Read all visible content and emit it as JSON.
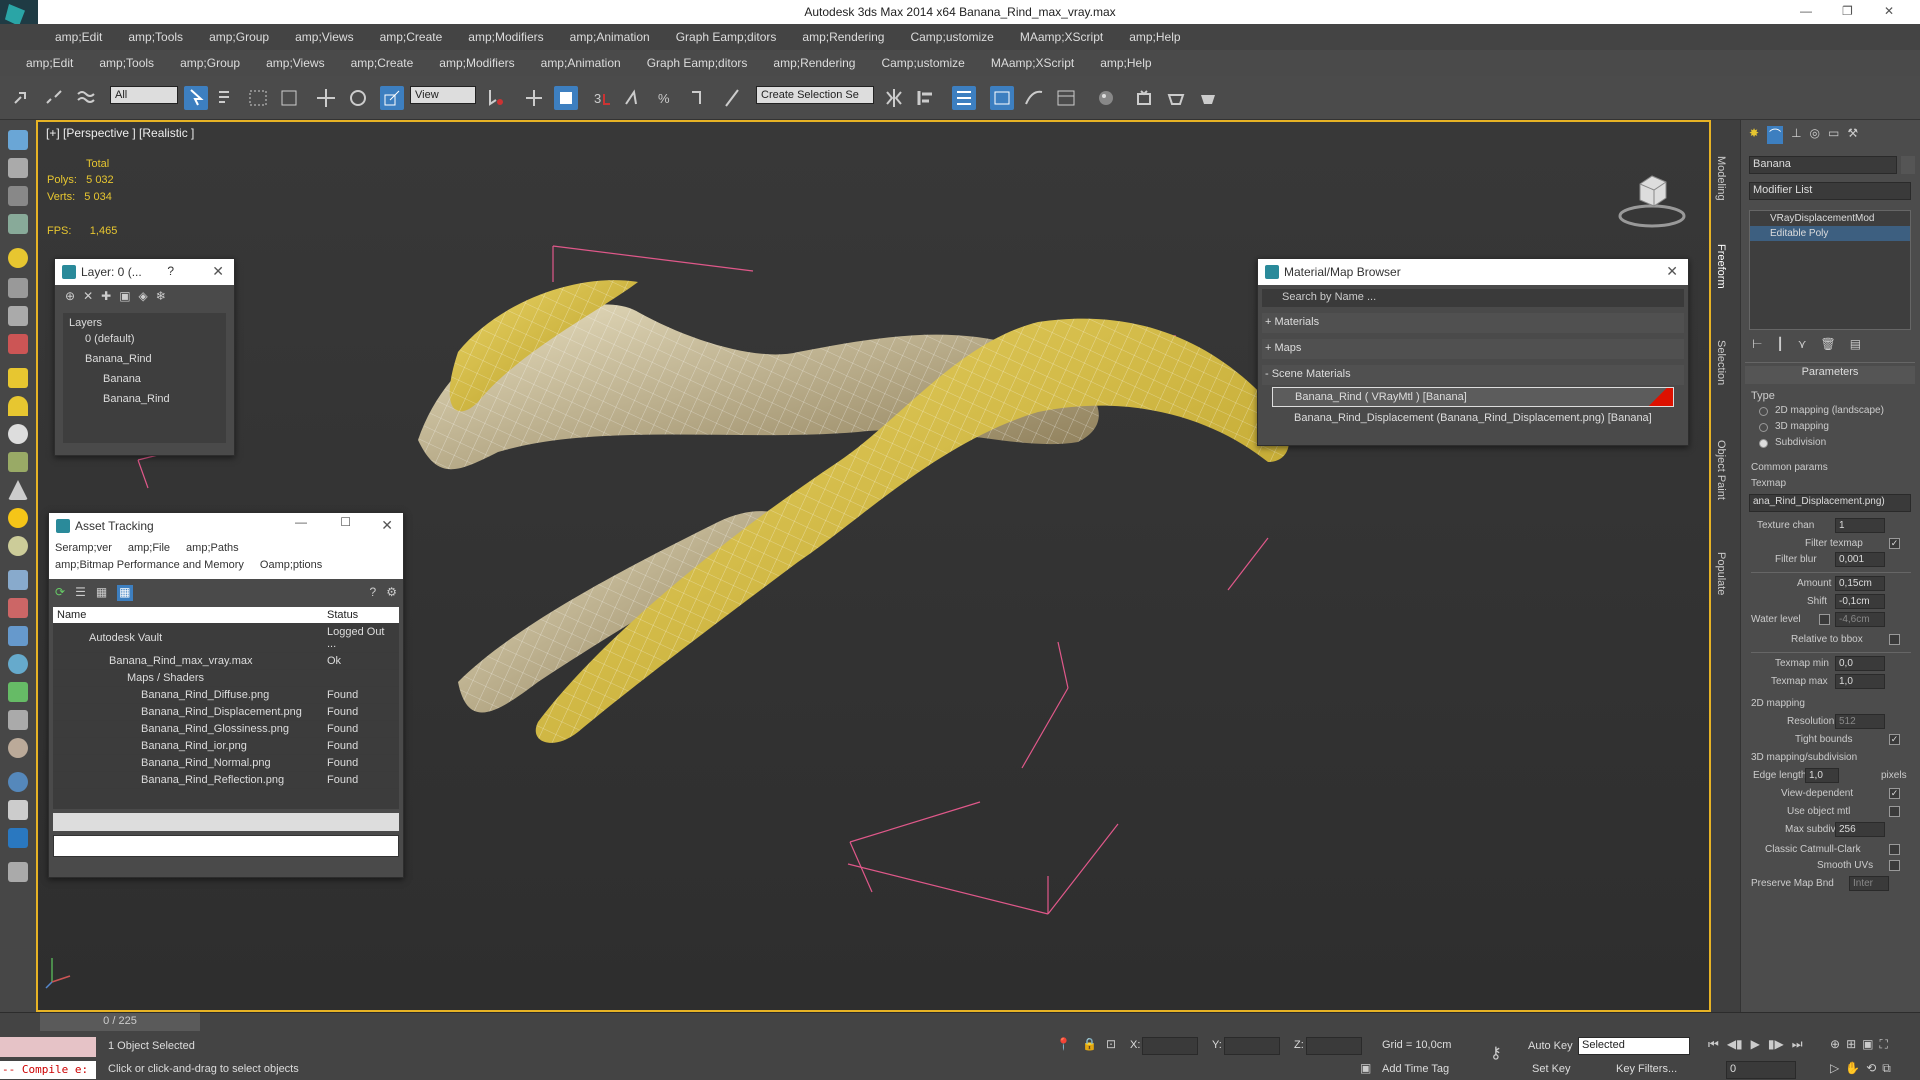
{
  "window": {
    "title": "Autodesk 3ds Max  2014 x64    Banana_Rind_max_vray.max"
  },
  "menu1": [
    "amp;Edit",
    "amp;Tools",
    "amp;Group",
    "amp;Views",
    "amp;Create",
    "amp;Modifiers",
    "amp;Animation",
    "Graph Eamp;ditors",
    "amp;Rendering",
    "Camp;ustomize",
    "MAamp;XScript",
    "amp;Help"
  ],
  "menu2": [
    "amp;Edit",
    "amp;Tools",
    "amp;Group",
    "amp;Views",
    "amp;Create",
    "amp;Modifiers",
    "amp;Animation",
    "Graph Eamp;ditors",
    "amp;Rendering",
    "Camp;ustomize",
    "MAamp;XScript",
    "amp;Help"
  ],
  "toolbar": {
    "filter": "All",
    "refcoord": "View",
    "selset": "Create Selection Se"
  },
  "viewport": {
    "label": "[+] [Perspective ] [Realistic ]",
    "total": "Total",
    "polys_label": "Polys:",
    "polys": "5 032",
    "verts_label": "Verts:",
    "verts": "5 034",
    "fps_label": "FPS:",
    "fps": "1,465"
  },
  "vtabs": [
    "Modeling",
    "Freeform",
    "Selection",
    "Object Paint",
    "Populate"
  ],
  "layer": {
    "title": "Layer: 0 (...",
    "help": "?",
    "header": "Layers",
    "items": [
      "0 (default)",
      "Banana_Rind",
      "Banana",
      "Banana_Rind"
    ]
  },
  "matbrowser": {
    "title": "Material/Map Browser",
    "search": "Search by Name ...",
    "materials": "+ Materials",
    "maps": "+ Maps",
    "scene": "- Scene Materials",
    "mat1": "Banana_Rind  ( VRayMtl ) [Banana]",
    "mat2": "Banana_Rind_Displacement (Banana_Rind_Displacement.png)  [Banana]"
  },
  "asset": {
    "title": "Asset Tracking",
    "menu": [
      "Seramp;ver",
      "amp;File",
      "amp;Paths"
    ],
    "menu2": [
      "amp;Bitmap Performance and Memory",
      "Oamp;ptions"
    ],
    "col_name": "Name",
    "col_status": "Status",
    "rows": [
      {
        "name": "Autodesk Vault",
        "status": "Logged Out ..."
      },
      {
        "name": "Banana_Rind_max_vray.max",
        "status": "Ok"
      },
      {
        "name": "Maps / Shaders",
        "status": ""
      },
      {
        "name": "Banana_Rind_Diffuse.png",
        "status": "Found"
      },
      {
        "name": "Banana_Rind_Displacement.png",
        "status": "Found"
      },
      {
        "name": "Banana_Rind_Glossiness.png",
        "status": "Found"
      },
      {
        "name": "Banana_Rind_ior.png",
        "status": "Found"
      },
      {
        "name": "Banana_Rind_Normal.png",
        "status": "Found"
      },
      {
        "name": "Banana_Rind_Reflection.png",
        "status": "Found"
      }
    ]
  },
  "cmdpanel": {
    "objname": "Banana",
    "modlist": "Modifier List",
    "stack": [
      "VRayDisplacementMod",
      "Editable Poly"
    ],
    "params": "Parameters",
    "type": "Type",
    "t1": "2D mapping (landscape)",
    "t2": "3D mapping",
    "t3": "Subdivision",
    "common": "Common params",
    "texmap": "Texmap",
    "texmap_val": "ana_Rind_Displacement.png)",
    "texchan": "Texture chan",
    "texchan_val": "1",
    "filtertex": "Filter texmap",
    "filterblur": "Filter blur",
    "filterblur_val": "0,001",
    "amount": "Amount",
    "amount_val": "0,15cm",
    "shift": "Shift",
    "shift_val": "-0,1cm",
    "water": "Water level",
    "water_val": "-4,6cm",
    "relbbox": "Relative to bbox",
    "tmin": "Texmap min",
    "tmin_val": "0,0",
    "tmax": "Texmap max",
    "tmax_val": "1,0",
    "map2d": "2D mapping",
    "res": "Resolution",
    "res_val": "512",
    "tight": "Tight bounds",
    "map3d": "3D mapping/subdivision",
    "edge": "Edge length",
    "edge_val": "1,0",
    "pixels": "pixels",
    "viewdep": "View-dependent",
    "useobj": "Use object mtl",
    "maxsub": "Max subdivs",
    "maxsub_val": "256",
    "catmull": "Classic Catmull-Clark",
    "smooth": "Smooth UVs",
    "preserve": "Preserve Map Bnd",
    "preserve_val": "Inter"
  },
  "status": {
    "frames": "0 / 225",
    "selected": "1 Object Selected",
    "prompt": "Click or click-and-drag to select objects",
    "compile": "-- Compile e:",
    "x": "X:",
    "y": "Y:",
    "z": "Z:",
    "grid": "Grid = 10,0cm",
    "autokey": "Auto Key",
    "setkey": "Set Key",
    "selmode": "Selected",
    "keyfilters": "Key Filters...",
    "addtag": "Add Time Tag",
    "frame": "0"
  },
  "colors": {
    "accent": "#e7b325",
    "banana": "#d8c040"
  }
}
